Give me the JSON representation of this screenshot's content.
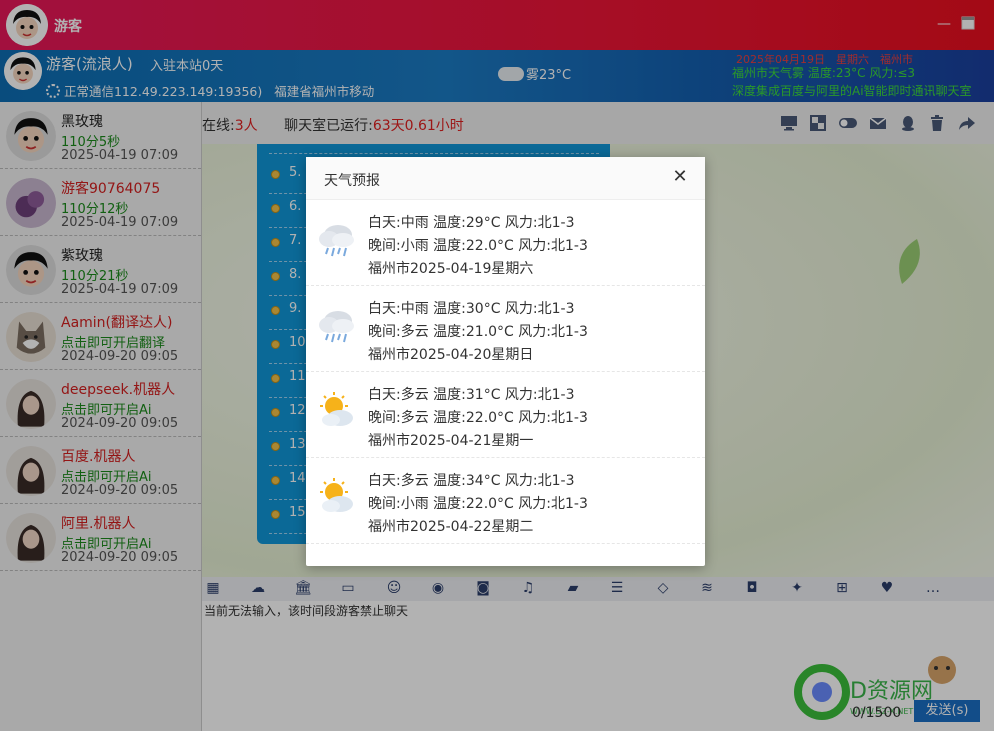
{
  "window": {
    "title": "游客"
  },
  "header": {
    "user_name": "游客(流浪人)",
    "stay": "入驻本站0天",
    "connection": "正常通信112.49.223.149:19356)",
    "location": "福建省福州市移动",
    "weather": "雾23°C",
    "date_line": "2025年04月19日　星期六　福州市",
    "ticker1": "福州市天气雾 温度:23°C 风力:≤3",
    "ticker2": "深度集成百度与阿里的Ai智能即时通讯聊天室"
  },
  "users": [
    {
      "name": "黑玫瑰",
      "score": "110分5秒",
      "time": "2025-04-19 07:09",
      "name_color": "#222222",
      "score_color": "#1a8a1a",
      "avatar": "cartoon"
    },
    {
      "name": "游客90764075",
      "score": "110分12秒",
      "time": "2025-04-19 07:09",
      "name_color": "#d42020",
      "score_color": "#1a8a1a",
      "avatar": "purple"
    },
    {
      "name": "紫玫瑰",
      "score": "110分21秒",
      "time": "2025-04-19 07:09",
      "name_color": "#222222",
      "score_color": "#1a8a1a",
      "avatar": "cartoon"
    },
    {
      "name": "Aamin(翻译达人)",
      "score": "点击即可开启翻译",
      "time": "2024-09-20 09:05",
      "name_color": "#d42020",
      "score_color": "#1a8a1a",
      "avatar": "husky"
    },
    {
      "name": "deepseek.机器人",
      "score": "点击即可开启Ai",
      "time": "2024-09-20 09:05",
      "name_color": "#d42020",
      "score_color": "#1a8a1a",
      "avatar": "girl"
    },
    {
      "name": "百度.机器人",
      "score": "点击即可开启Ai",
      "time": "2024-09-20 09:05",
      "name_color": "#d42020",
      "score_color": "#1a8a1a",
      "avatar": "girl"
    },
    {
      "name": "阿里.机器人",
      "score": "点击即可开启Ai",
      "time": "2024-09-20 09:05",
      "name_color": "#d42020",
      "score_color": "#1a8a1a",
      "avatar": "girl"
    }
  ],
  "status": {
    "online_label": "在线:",
    "online_count": "3人",
    "uptime_label": "聊天室已运行:",
    "uptime_value": "63天0.61小时"
  },
  "list_numbers": [
    "5.",
    "6.",
    "7.",
    "8.",
    "9.",
    "10.",
    "11.",
    "12.",
    "13.",
    "14.",
    "15."
  ],
  "input": {
    "placeholder": "当前无法输入，该时间段游客禁止聊天",
    "counter": "0/1500",
    "send_label": "发送(s)"
  },
  "modal": {
    "title": "天气预报",
    "days": [
      {
        "day": "白天:中雨 温度:29°C 风力:北1-3",
        "night": "晚间:小雨 温度:22.0°C 风力:北1-3",
        "date": "福州市2025-04-19星期六",
        "icon": "rain-icon"
      },
      {
        "day": "白天:中雨 温度:30°C 风力:北1-3",
        "night": "晚间:多云 温度:21.0°C 风力:北1-3",
        "date": "福州市2025-04-20星期日",
        "icon": "rain-icon"
      },
      {
        "day": "白天:多云 温度:31°C 风力:北1-3",
        "night": "晚间:多云 温度:22.0°C 风力:北1-3",
        "date": "福州市2025-04-21星期一",
        "icon": "sun-cloud-icon"
      },
      {
        "day": "白天:多云 温度:34°C 风力:北1-3",
        "night": "晚间:小雨 温度:22.0°C 风力:北1-3",
        "date": "福州市2025-04-22星期二",
        "icon": "sun-cloud-icon"
      }
    ]
  },
  "watermark": {
    "text": "D资源网",
    "sub": "WWW.DZ-X.NET"
  },
  "colors": {
    "titlebar": "#ee1537",
    "header": "#1b7bc4",
    "accent_green": "#3edc3a",
    "accent_red": "#e02020",
    "send": "#1a6fc4"
  }
}
